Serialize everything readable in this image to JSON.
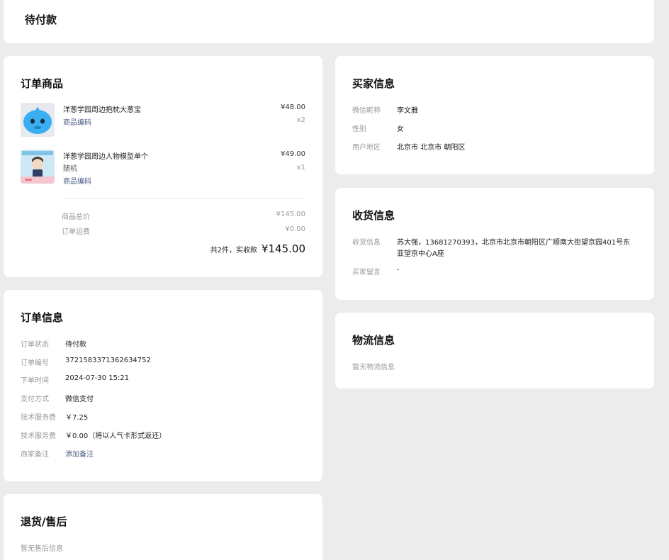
{
  "header": {
    "status": "待付款"
  },
  "order_items": {
    "title": "订单商品",
    "items": [
      {
        "name": "洋葱学园周边抱枕大葱宝",
        "spec": "",
        "code_link": "商品编码",
        "price": "¥48.00",
        "qty": "x2"
      },
      {
        "name": "洋葱学园周边人物模型单个",
        "spec": "随机",
        "code_link": "商品编码",
        "price": "¥49.00",
        "qty": "x1"
      }
    ],
    "summary": {
      "goods_total_label": "商品总价",
      "goods_total": "¥145.00",
      "shipping_label": "订单运费",
      "shipping": "¥0.00",
      "count_text": "共2件，实收款",
      "paid": "¥145.00"
    }
  },
  "order_info": {
    "title": "订单信息",
    "rows": [
      {
        "label": "订单状态",
        "value": "待付款"
      },
      {
        "label": "订单编号",
        "value": "3721583371362634752"
      },
      {
        "label": "下单时间",
        "value": "2024-07-30 15:21"
      },
      {
        "label": "支付方式",
        "value": "微信支付"
      },
      {
        "label": "技术服务费",
        "value": "￥7.25"
      },
      {
        "label": "技术服务费",
        "value": "￥0.00（将以人气卡形式返还）"
      },
      {
        "label": "商家备注",
        "value": "添加备注"
      }
    ]
  },
  "after_sale": {
    "title": "退货/售后",
    "empty": "暂无售后信息"
  },
  "buyer_info": {
    "title": "买家信息",
    "rows": [
      {
        "label": "微信昵称",
        "value": "李文雅"
      },
      {
        "label": "性别",
        "value": "女"
      },
      {
        "label": "用户地区",
        "value": "北京市 北京市 朝阳区"
      }
    ]
  },
  "receive_info": {
    "title": "收货信息",
    "address_label": "收货信息",
    "address_line1": "苏大强，13681270393，北京市北京市朝阳区广顺南大街望京园401号东",
    "address_line2": "亚望京中心A座",
    "message_label": "买家留言",
    "message": "-"
  },
  "logistics": {
    "title": "物流信息",
    "empty": "暂无物流信息"
  },
  "colors": {
    "background": "#ececec",
    "card": "#ffffff",
    "link": "#4a5c86",
    "muted": "#999999"
  }
}
